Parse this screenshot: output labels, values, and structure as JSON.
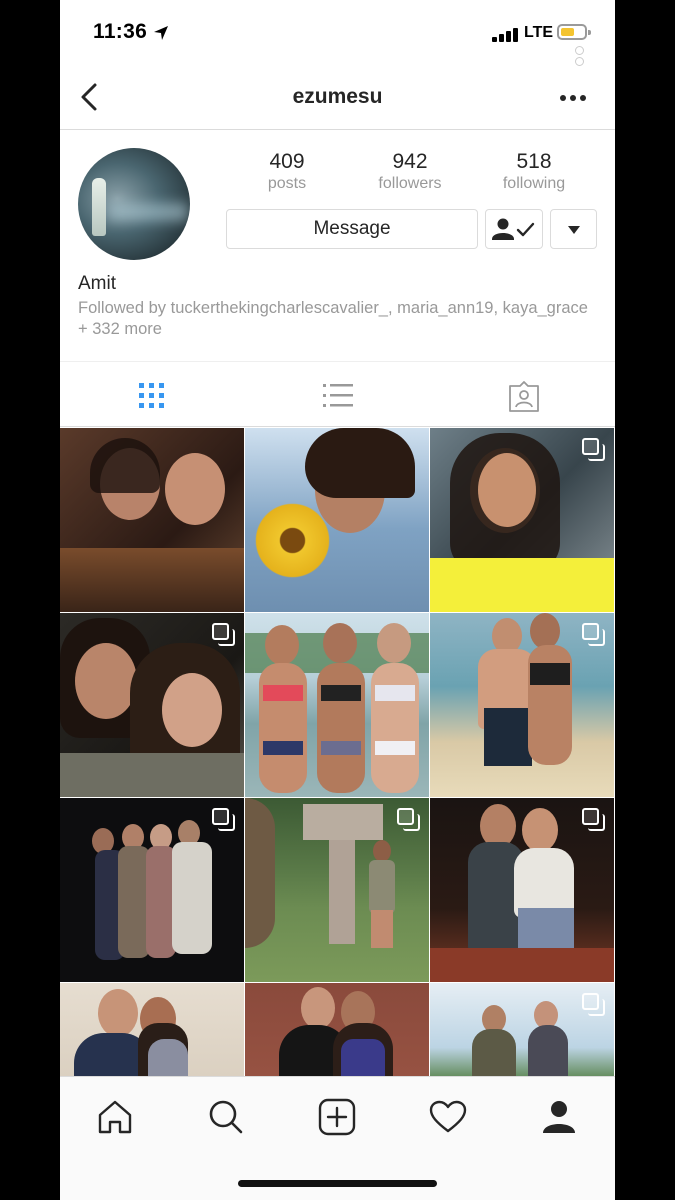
{
  "status_bar": {
    "time": "11:36",
    "network": "LTE",
    "battery_level": 0.5,
    "battery_color": "#f4c430"
  },
  "nav": {
    "title": "ezumesu",
    "back_icon": "chevron-left-icon",
    "more_icon": "more-horizontal-icon"
  },
  "profile": {
    "stats": [
      {
        "value": "409",
        "label": "posts"
      },
      {
        "value": "942",
        "label": "followers"
      },
      {
        "value": "518",
        "label": "following"
      }
    ],
    "message_label": "Message",
    "following_icon": "person-check-icon",
    "dropdown_icon": "caret-down-icon",
    "full_name": "Amit",
    "followed_by": "Followed by tuckerthekingcharlescavalier_, maria_ann19, kaya_grace + 332 more"
  },
  "tabs": [
    {
      "name": "grid",
      "icon": "grid-icon",
      "active": true,
      "active_color": "#3897f0"
    },
    {
      "name": "list",
      "icon": "list-icon",
      "active": false
    },
    {
      "name": "tagged",
      "icon": "tagged-person-icon",
      "active": false
    }
  ],
  "posts": [
    {
      "id": 1,
      "multi": false
    },
    {
      "id": 2,
      "multi": false
    },
    {
      "id": 3,
      "multi": true
    },
    {
      "id": 4,
      "multi": true
    },
    {
      "id": 5,
      "multi": false
    },
    {
      "id": 6,
      "multi": true
    },
    {
      "id": 7,
      "multi": true
    },
    {
      "id": 8,
      "multi": true
    },
    {
      "id": 9,
      "multi": true
    },
    {
      "id": 10,
      "multi": false
    },
    {
      "id": 11,
      "multi": false
    },
    {
      "id": 12,
      "multi": true
    }
  ],
  "bottom_nav": [
    {
      "name": "home",
      "icon": "home-icon"
    },
    {
      "name": "search",
      "icon": "search-icon"
    },
    {
      "name": "new-post",
      "icon": "plus-square-icon"
    },
    {
      "name": "activity",
      "icon": "heart-icon"
    },
    {
      "name": "profile",
      "icon": "profile-icon",
      "active": true
    }
  ]
}
